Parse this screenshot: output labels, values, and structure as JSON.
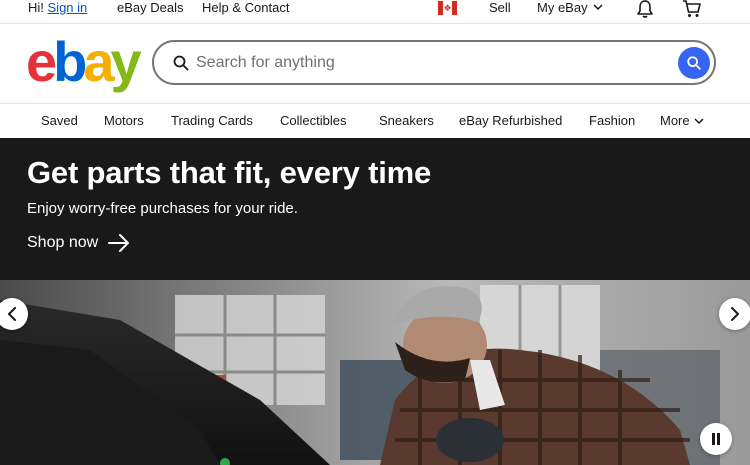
{
  "topbar": {
    "greeting": "Hi!",
    "sign_in": "Sign in",
    "deals": "eBay Deals",
    "help": "Help & Contact",
    "sell": "Sell",
    "my_ebay": "My eBay"
  },
  "logo": {
    "e": "e",
    "b": "b",
    "a": "a",
    "y": "y"
  },
  "search": {
    "placeholder": "Search for anything"
  },
  "nav": {
    "items": [
      "Saved",
      "Motors",
      "Trading Cards",
      "Collectibles",
      "Sneakers",
      "eBay Refurbished",
      "Fashion",
      "More"
    ]
  },
  "banner": {
    "title": "Get parts that fit, every time",
    "subtitle": "Enjoy worry-free purchases for your ride.",
    "cta": "Shop now"
  },
  "colors": {
    "accent": "#3665f3",
    "link": "#0654ba",
    "banner_bg": "#191919",
    "logo_e": "#e53238",
    "logo_b": "#0064d2",
    "logo_a": "#f5af02",
    "logo_y": "#86b817"
  },
  "icons": [
    "canada-flag-icon",
    "chevron-down-icon",
    "bell-icon",
    "cart-icon",
    "search-icon",
    "arrow-right-icon",
    "chevron-left-icon",
    "chevron-right-icon",
    "pause-icon"
  ]
}
